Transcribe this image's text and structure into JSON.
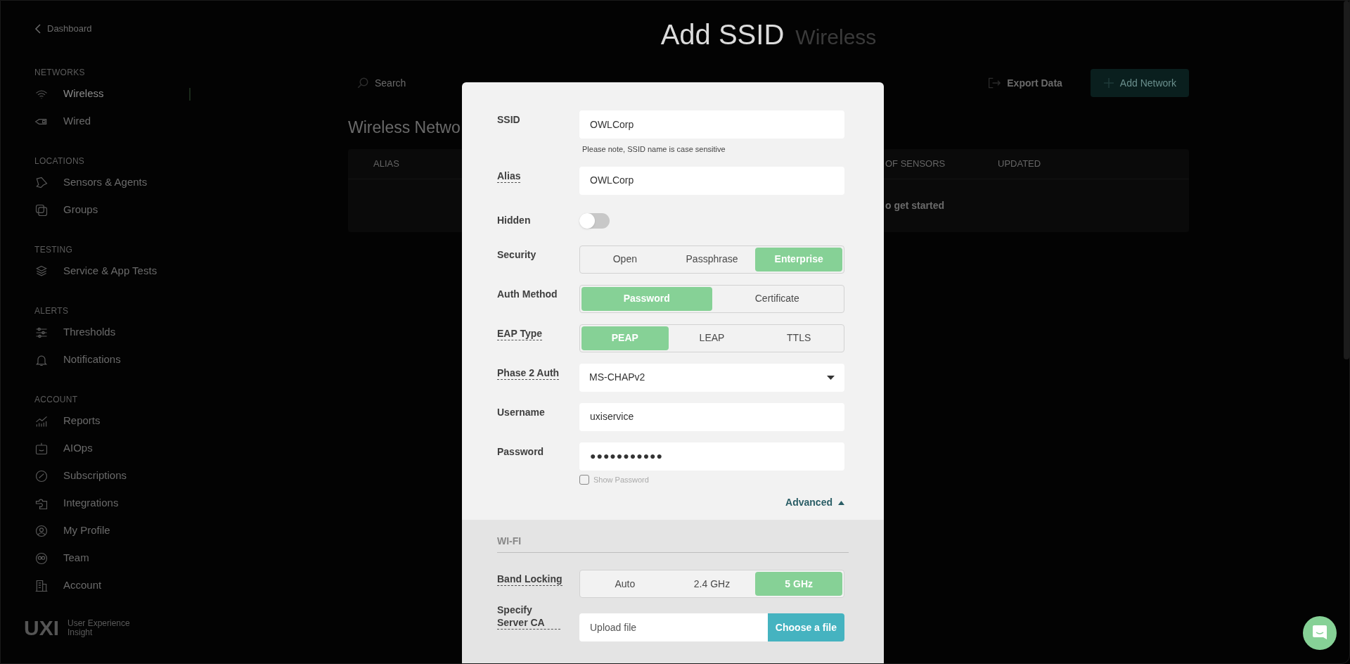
{
  "sidebar": {
    "back_link": "Dashboard",
    "sections": [
      {
        "heading": "NETWORKS",
        "items": [
          {
            "label": "Wireless",
            "selected": true
          },
          {
            "label": "Wired",
            "selected": false
          }
        ]
      },
      {
        "heading": "LOCATIONS",
        "items": [
          {
            "label": "Sensors & Agents",
            "selected": false
          },
          {
            "label": "Groups",
            "selected": false
          }
        ]
      },
      {
        "heading": "TESTING",
        "items": [
          {
            "label": "Service & App Tests",
            "selected": false
          }
        ]
      },
      {
        "heading": "ALERTS",
        "items": [
          {
            "label": "Thresholds",
            "selected": false
          },
          {
            "label": "Notifications",
            "selected": false
          }
        ]
      },
      {
        "heading": "ACCOUNT",
        "items": [
          {
            "label": "Reports",
            "selected": false
          },
          {
            "label": "AIOps",
            "selected": false
          },
          {
            "label": "Subscriptions",
            "selected": false
          },
          {
            "label": "Integrations",
            "selected": false
          },
          {
            "label": "My Profile",
            "selected": false
          },
          {
            "label": "Team",
            "selected": false
          },
          {
            "label": "Account",
            "selected": false
          }
        ]
      }
    ]
  },
  "logo": {
    "mark": "UXI",
    "tagline": [
      "User Experience",
      "Insight"
    ]
  },
  "header": {
    "title": "Add SSID",
    "subtitle": "Wireless"
  },
  "toolbar": {
    "search_placeholder": "Search",
    "export_label": "Export Data",
    "add_label": "Add Network"
  },
  "networks": {
    "heading": "Wireless Netwo",
    "columns": [
      "ALIAS",
      "OF SENSORS",
      "UPDATED"
    ],
    "empty_text": "o get started"
  },
  "modal": {
    "fields": [
      {
        "kind": "text",
        "label": "SSID",
        "tooltip": false,
        "value": "OWLCorp",
        "note": "Please note, SSID name is case sensitive"
      },
      {
        "kind": "text",
        "label": "Alias",
        "tooltip": true,
        "value": "OWLCorp"
      },
      {
        "kind": "toggle",
        "label": "Hidden",
        "tooltip": false,
        "on": false
      },
      {
        "kind": "segmented",
        "label": "Security",
        "tooltip": false,
        "options": [
          {
            "label": "Open",
            "selected": false
          },
          {
            "label": "Passphrase",
            "selected": false
          },
          {
            "label": "Enterprise",
            "selected": true
          }
        ]
      },
      {
        "kind": "segmented",
        "label": "Auth Method",
        "tooltip": false,
        "options": [
          {
            "label": "Password",
            "selected": true
          },
          {
            "label": "Certificate",
            "selected": false
          }
        ]
      },
      {
        "kind": "segmented",
        "label": "EAP Type",
        "tooltip": true,
        "options": [
          {
            "label": "PEAP",
            "selected": true
          },
          {
            "label": "LEAP",
            "selected": false
          },
          {
            "label": "TTLS",
            "selected": false
          }
        ]
      },
      {
        "kind": "select",
        "label": "Phase 2 Auth",
        "tooltip": true,
        "value": "MS-CHAPv2"
      },
      {
        "kind": "text",
        "label": "Username",
        "tooltip": false,
        "value": "uxiservice"
      },
      {
        "kind": "password",
        "label": "Password",
        "tooltip": false,
        "value": "●●●●●●●●●●●",
        "show_label": "Show Password",
        "show_checked": false
      }
    ],
    "advanced": {
      "label": "Advanced",
      "expanded": true
    },
    "wifi": {
      "heading": "WI-FI",
      "fields": [
        {
          "kind": "segmented",
          "label": "Band Locking",
          "tooltip": true,
          "options": [
            {
              "label": "Auto",
              "selected": false
            },
            {
              "label": "2.4 GHz",
              "selected": false
            },
            {
              "label": "5 GHz",
              "selected": true
            }
          ]
        },
        {
          "kind": "file",
          "label": "Specify Server CA",
          "tooltip": true,
          "placeholder": "Upload file",
          "button": "Choose a file"
        }
      ]
    }
  }
}
